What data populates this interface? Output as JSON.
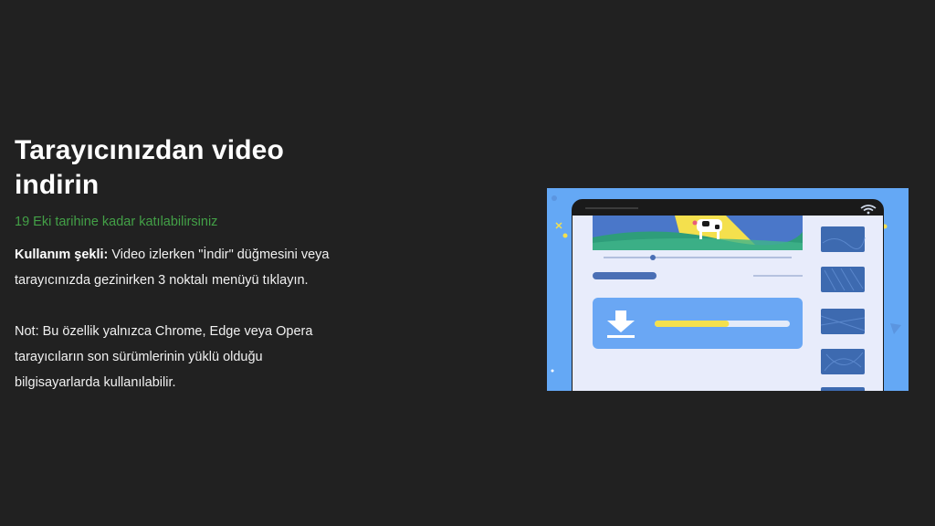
{
  "promo": {
    "title": "Tarayıcınızdan video indirin",
    "deadline": "19 Eki tarihine kadar katılabilirsiniz",
    "usage_label": "Kullanım şekli:",
    "usage_text": " Video izlerken \"İndir\" düğmesini veya tarayıcınızda gezinirken 3 noktalı menüyü tıklayın.",
    "note": "Not: Bu özellik yalnızca Chrome, Edge veya Opera tarayıcıların son sürümlerinin yüklü olduğu bilgisayarlarda kullanılabilir.",
    "download_progress": 0.55
  },
  "colors": {
    "background": "#212121",
    "deadline_green": "#43a047",
    "illustration_blue": "#64a8f5",
    "progress_yellow": "#f4e04d"
  },
  "icons": {
    "download": "download-arrow-icon",
    "wifi": "wifi-icon"
  }
}
